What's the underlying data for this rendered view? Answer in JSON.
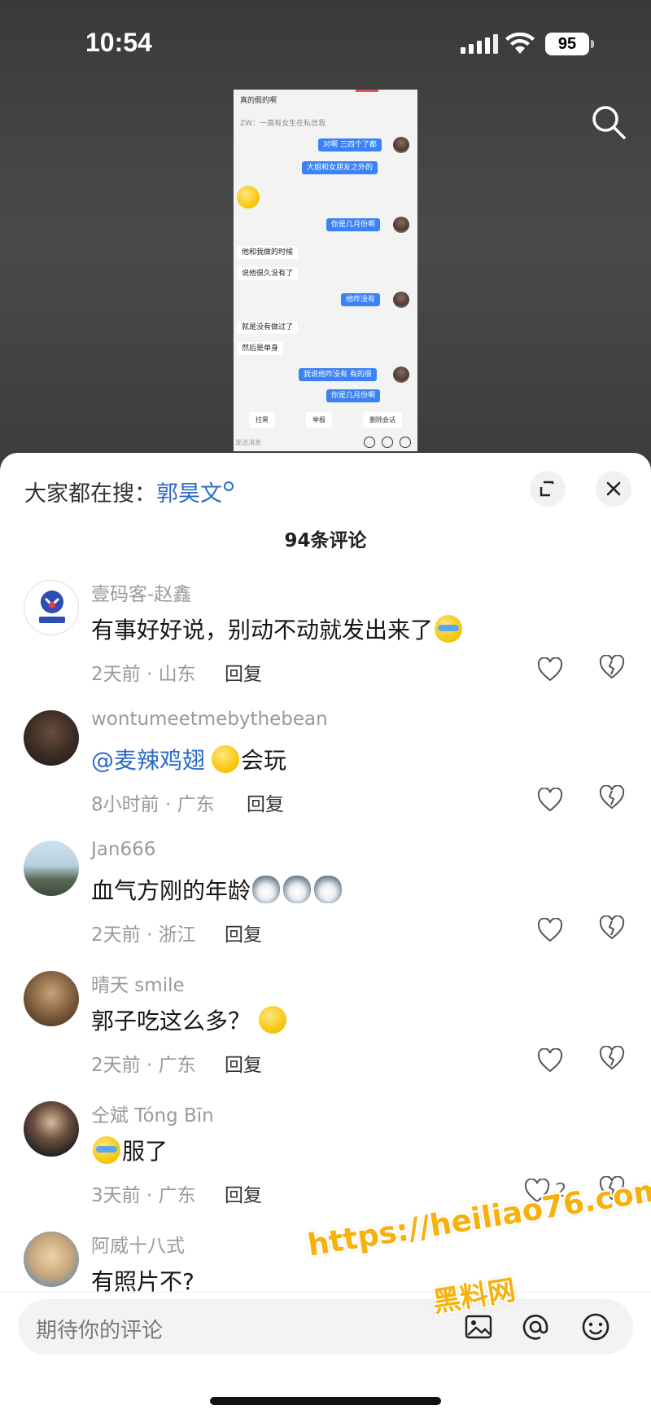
{
  "status_bar": {
    "time": "10:54",
    "battery": "95"
  },
  "chat_screenshot": {
    "messages": [
      {
        "side": "left",
        "text": "真的假的啊"
      },
      {
        "side": "system",
        "text": "ZW：一直有女生在私信我"
      },
      {
        "side": "right",
        "text": "对啊 三四个了都"
      },
      {
        "side": "right",
        "text": "大姐和女朋友之外的"
      },
      {
        "side": "right",
        "text": "你是几月份啊"
      },
      {
        "side": "left",
        "text": "他和我做的时候"
      },
      {
        "side": "left",
        "text": "说他很久没有了"
      },
      {
        "side": "right",
        "text": "他咋没有"
      },
      {
        "side": "left",
        "text": "就是没有做过了"
      },
      {
        "side": "left",
        "text": "然后是单身"
      },
      {
        "side": "right",
        "text": "我说他咋没有 有的很"
      },
      {
        "side": "right",
        "text": "你是几月份啊"
      }
    ],
    "actions": [
      "拉黑",
      "举报",
      "删除会话"
    ],
    "input_placeholder": "发送消息"
  },
  "hot_search": {
    "prefix": "大家都在搜：",
    "term": "郭昊文"
  },
  "comment_count": "94条评论",
  "comments": [
    {
      "name": "壹码客-赵鑫",
      "text": "有事好好说，别动不动就发出来了",
      "time": "2天前 · 山东",
      "reply": "回复",
      "likes": ""
    },
    {
      "name": "wontumeetmebythebean",
      "mention": "@麦辣鸡翅",
      "text": "会玩",
      "time": "8小时前 · 广东",
      "reply": "回复",
      "likes": ""
    },
    {
      "name": "Jan666",
      "text": "血气方刚的年龄",
      "time": "2天前 · 浙江",
      "reply": "回复",
      "likes": ""
    },
    {
      "name": "晴天 smile",
      "text": "郭子吃这么多？",
      "time": "2天前 · 广东",
      "reply": "回复",
      "likes": ""
    },
    {
      "name": "仝斌 Tóng Bīn",
      "text": "服了",
      "time": "3天前 · 广东",
      "reply": "回复",
      "likes": "2"
    },
    {
      "name": "阿威十八式",
      "text": "有照片不?",
      "time": "",
      "reply": "",
      "likes": ""
    }
  ],
  "input": {
    "placeholder": "期待你的评论"
  },
  "watermark": {
    "line1": "https://heiliao76.com",
    "line2": "黑料网"
  },
  "colors": {
    "accent_blue": "#2a6bc7",
    "watermark": "#f7b10a",
    "chat_bubble": "#3b82f6"
  }
}
